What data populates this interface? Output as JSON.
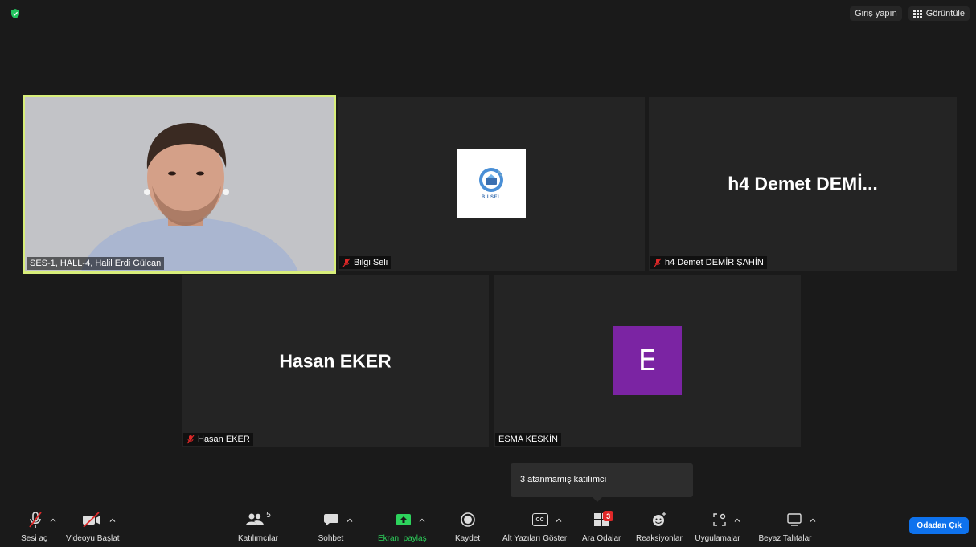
{
  "top_bar": {
    "sign_in_label": "Giriş yapın",
    "view_label": "Görüntüle"
  },
  "tiles": {
    "halil": {
      "name": "SES-1, HALL-4, Halil Erdi Gülcan"
    },
    "bilgi": {
      "name": "Bilgi Seli",
      "logo_text": "BİLSEL"
    },
    "demet": {
      "name": "h4 Demet DEMİR ŞAHİN",
      "display": "h4 Demet DEMİ..."
    },
    "hasan": {
      "name": "Hasan EKER",
      "display": "Hasan EKER"
    },
    "esma": {
      "name": "ESMA KESKİN",
      "avatar_letter": "E"
    }
  },
  "tooltip": {
    "text": "3 atanmamış katılımcı"
  },
  "toolbar": {
    "mute_label": "Sesi aç",
    "video_label": "Videoyu Başlat",
    "participants_label": "Katılımcılar",
    "participants_count": "5",
    "chat_label": "Sohbet",
    "share_label": "Ekranı paylaş",
    "record_label": "Kaydet",
    "cc_label": "Alt Yazıları Göster",
    "cc_icon_text": "CC",
    "breakout_label": "Ara Odalar",
    "breakout_badge": "3",
    "reactions_label": "Reaksiyonlar",
    "apps_label": "Uygulamalar",
    "whiteboard_label": "Beyaz Tahtalar",
    "leave_label": "Odadan Çık"
  },
  "colors": {
    "background": "#1a1a1a",
    "tile": "#242424",
    "active_speaker_border": "#d8ee7a",
    "share_green": "#2dd35c",
    "leave_blue": "#0e72ed",
    "badge_red": "#e02828",
    "avatar_purple": "#7b24a3",
    "mic_off_red": "#e02828"
  }
}
